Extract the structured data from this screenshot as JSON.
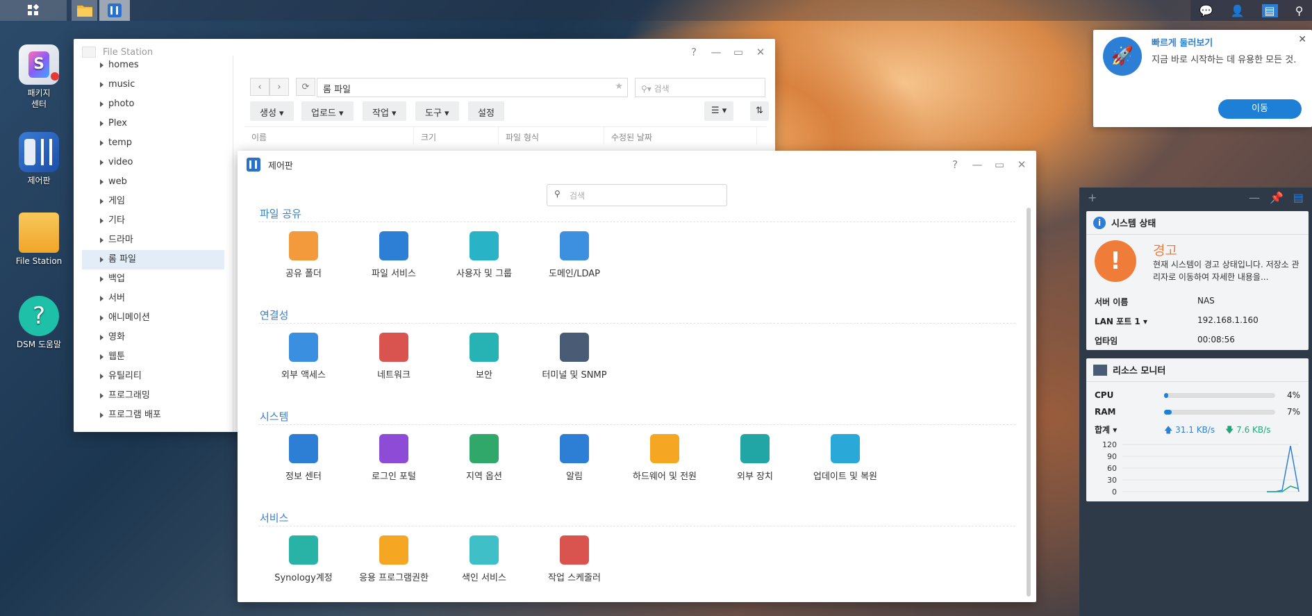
{
  "taskbar": {
    "icons": [
      "grid-icon",
      "folder-icon",
      "control-panel-icon"
    ],
    "right_icons": [
      "chat-icon",
      "user-icon",
      "widget-icon",
      "search-icon"
    ]
  },
  "desktop": {
    "items": [
      {
        "label": "패키지\n센터",
        "icon": "package-center-icon"
      },
      {
        "label": "제어판",
        "icon": "control-panel-icon"
      },
      {
        "label": "File Station",
        "icon": "folder-icon"
      },
      {
        "label": "DSM 도움말",
        "icon": "help-icon"
      }
    ]
  },
  "file_station": {
    "title": "File Station",
    "tree": [
      "homes",
      "music",
      "photo",
      "Plex",
      "temp",
      "video",
      "web",
      "게임",
      "기타",
      "드라마",
      "롬 파일",
      "백업",
      "서버",
      "애니메이션",
      "영화",
      "웹툰",
      "유틸리티",
      "프로그래밍",
      "프로그램 배포"
    ],
    "selected": "롬 파일",
    "path": "롬 파일",
    "search_placeholder": "검색",
    "toolbar": {
      "create": "생성",
      "upload": "업로드",
      "action": "작업",
      "tools": "도구",
      "settings": "설정"
    },
    "columns": [
      "이름",
      "크기",
      "파일 형식",
      "수정된 날짜"
    ]
  },
  "control_panel": {
    "title": "제어판",
    "search_placeholder": "검색",
    "sections": [
      {
        "title": "파일 공유",
        "items": [
          {
            "label": "공유 폴더",
            "icon": "shared-folder-icon",
            "color": "#f39a3c"
          },
          {
            "label": "파일 서비스",
            "icon": "file-services-icon",
            "color": "#2d7fd6"
          },
          {
            "label": "사용자 및 그룹",
            "icon": "user-group-icon",
            "color": "#29b3c7"
          },
          {
            "label": "도메인/LDAP",
            "icon": "domain-ldap-icon",
            "color": "#3d8fe0"
          }
        ]
      },
      {
        "title": "연결성",
        "items": [
          {
            "label": "외부 액세스",
            "icon": "external-access-icon",
            "color": "#3a8fe0"
          },
          {
            "label": "네트워크",
            "icon": "network-icon",
            "color": "#d9534f"
          },
          {
            "label": "보안",
            "icon": "security-icon",
            "color": "#27b3b3"
          },
          {
            "label": "터미널 및 SNMP",
            "icon": "terminal-icon",
            "color": "#4a5c75"
          }
        ]
      },
      {
        "title": "시스템",
        "items": [
          {
            "label": "정보 센터",
            "icon": "info-center-icon",
            "color": "#2d7fd6"
          },
          {
            "label": "로그인 포털",
            "icon": "login-portal-icon",
            "color": "#8e4bd6"
          },
          {
            "label": "지역 옵션",
            "icon": "regional-options-icon",
            "color": "#2fa86a"
          },
          {
            "label": "알림",
            "icon": "notification-icon",
            "color": "#2d7fd6"
          },
          {
            "label": "하드웨어 및 전원",
            "icon": "hardware-power-icon",
            "color": "#f5a623"
          },
          {
            "label": "외부 장치",
            "icon": "external-devices-icon",
            "color": "#22a5a5"
          },
          {
            "label": "업데이트 및 복원",
            "icon": "update-restore-icon",
            "color": "#2aa9d8"
          }
        ]
      },
      {
        "title": "서비스",
        "items": [
          {
            "label": "Synology계정",
            "icon": "synology-account-icon",
            "color": "#29b3a7"
          },
          {
            "label": "응용 프로그램권한",
            "icon": "app-privileges-icon",
            "color": "#f5a623"
          },
          {
            "label": "색인 서비스",
            "icon": "indexing-service-icon",
            "color": "#3fc0c8"
          },
          {
            "label": "작업 스케줄러",
            "icon": "task-scheduler-icon",
            "color": "#d9534f"
          }
        ]
      }
    ]
  },
  "quick_start": {
    "title": "빠르게 둘러보기",
    "desc": "지금 바로 시작하는 데 유용한 모든 것.",
    "button": "이동"
  },
  "system_health": {
    "title": "시스템 상태",
    "status": "경고",
    "message": "현재 시스템이 경고 상태입니다. 저장소 관리자로 이동하여 자세한 내용을...",
    "rows": [
      {
        "k": "서버 이름",
        "v": "NAS"
      },
      {
        "k": "LAN 포트 1 ▾",
        "v": "192.168.1.160"
      },
      {
        "k": "업타임",
        "v": "00:08:56"
      }
    ]
  },
  "resource_monitor": {
    "title": "리소스 모니터",
    "cpu_label": "CPU",
    "cpu": "4%",
    "cpu_frac": 0.04,
    "ram_label": "RAM",
    "ram": "7%",
    "ram_frac": 0.07,
    "total_label": "합계 ▾",
    "up": "31.1 KB/s",
    "down": "7.6 KB/s",
    "yticks": [
      "120",
      "90",
      "60",
      "30",
      "0"
    ]
  }
}
